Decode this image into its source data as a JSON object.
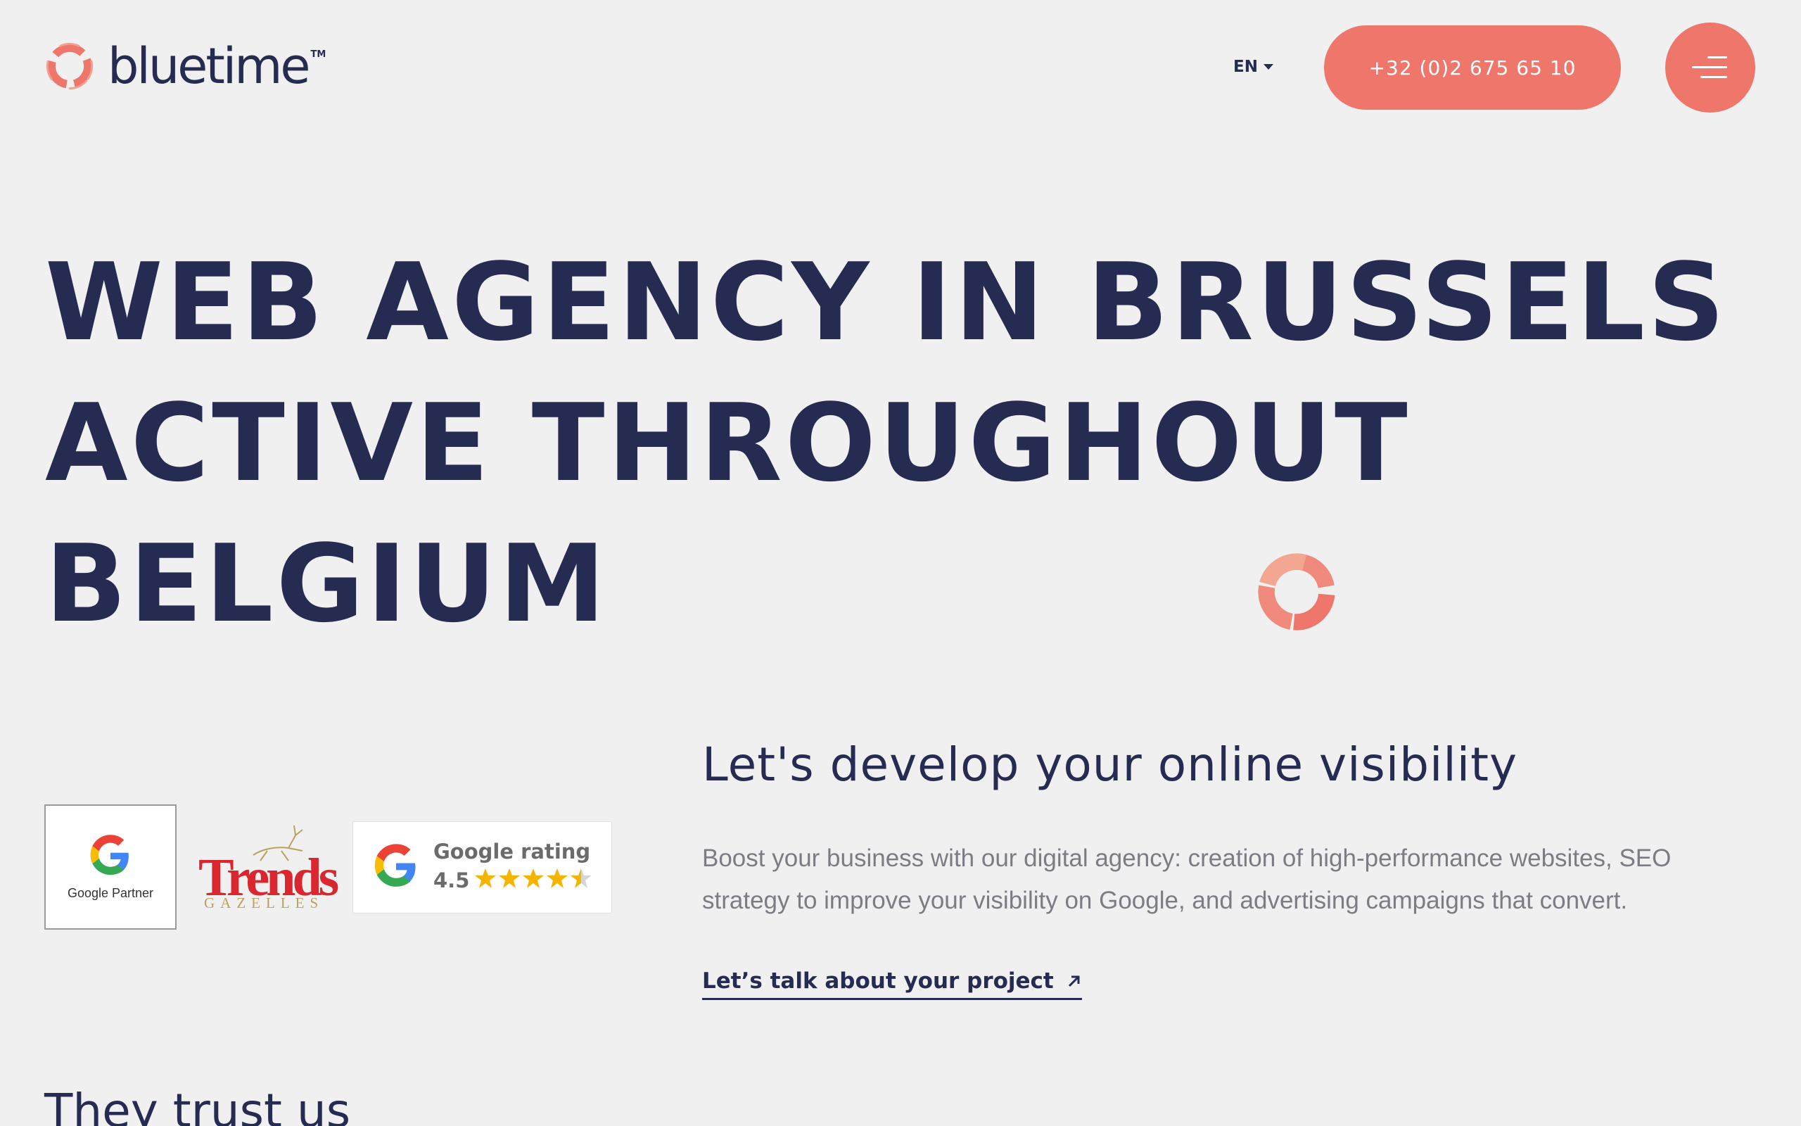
{
  "header": {
    "logo_text": "bluetime",
    "logo_tm": "TM",
    "language": "EN",
    "phone": "+32 (0)2 675 65 10"
  },
  "hero": {
    "title_lines": [
      "WEB AGENCY IN BRUSSELS",
      "ACTIVE THROUGHOUT",
      "BELGIUM"
    ]
  },
  "badges": {
    "google_partner": "Google Partner",
    "trends_word": "Trends",
    "trends_sub": "GAZELLES",
    "rating_title": "Google rating",
    "rating_value": "4.5",
    "rating_stars": 4.5
  },
  "content": {
    "subtitle": "Let's develop your online visibility",
    "description": "Boost your business with our digital agency: creation of high-performance websites, SEO strategy to improve your visibility on Google, and advertising campaigns that convert.",
    "cta": "Let’s talk about your project"
  },
  "trust": {
    "title": "They trust us"
  },
  "colors": {
    "accent": "#ef766b",
    "navy": "#262b52",
    "background": "#f0f0f1"
  },
  "icons": [
    "bluetime-logo-icon",
    "chevron-down-icon",
    "menu-icon",
    "google-g-icon",
    "star-icon",
    "arrow-up-right-icon",
    "deer-icon"
  ]
}
